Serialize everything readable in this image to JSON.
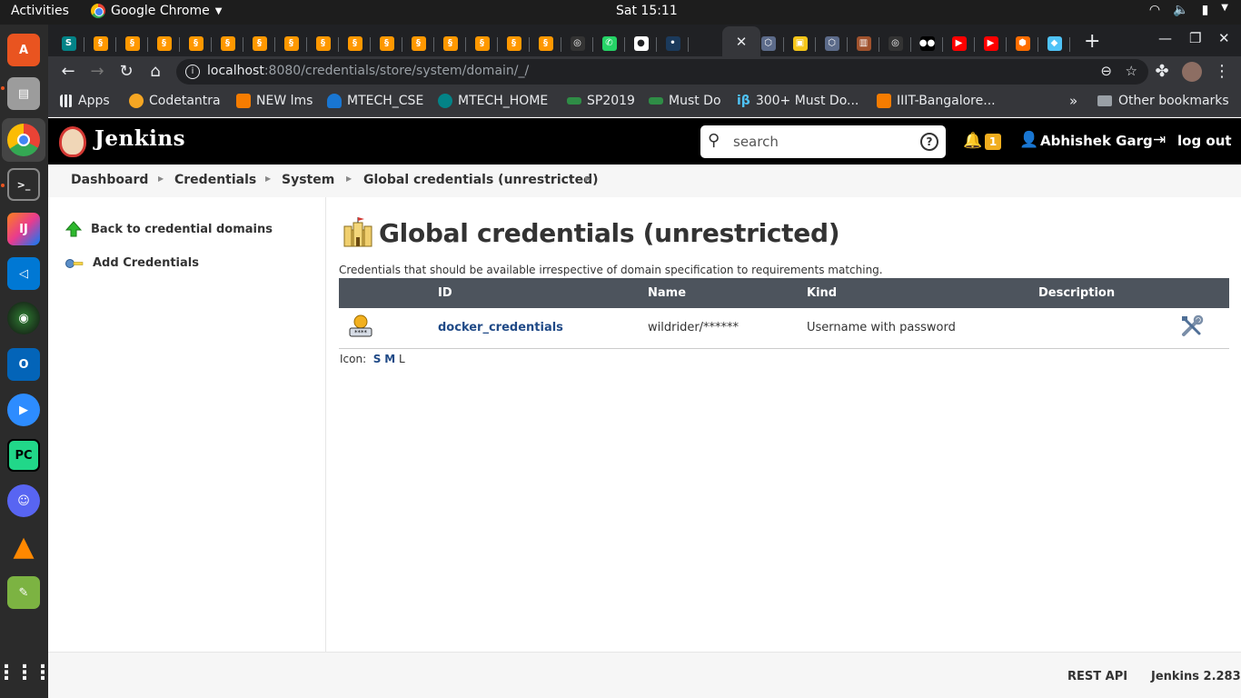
{
  "os": {
    "activities": "Activities",
    "app_menu": "Google Chrome",
    "clock": "Sat 15:11"
  },
  "browser": {
    "url_host": "localhost",
    "url_rest": ":8080/credentials/store/system/domain/_/",
    "bookmarks": [
      "Apps",
      "Codetantra",
      "NEW lms",
      "MTECH_CSE",
      "MTECH_HOME",
      "SP2019",
      "Must Do",
      "300+ Must Do...",
      "IIIT-Bangalore..."
    ],
    "bookmarks_more": "»",
    "other_bookmarks": "Other bookmarks"
  },
  "jenkins": {
    "title": "Jenkins",
    "search_placeholder": "search",
    "notification_count": "1",
    "user": "Abhishek Garg",
    "logout": "log out"
  },
  "breadcrumb": [
    "Dashboard",
    "Credentials",
    "System",
    "Global credentials (unrestricted)"
  ],
  "sidepanel": {
    "back": "Back to credential domains",
    "add": "Add Credentials"
  },
  "main": {
    "title": "Global credentials (unrestricted)",
    "description": "Credentials that should be available irrespective of domain specification to requirements matching.",
    "columns": {
      "id": "ID",
      "name": "Name",
      "kind": "Kind",
      "description": "Description"
    },
    "rows": [
      {
        "id": "docker_credentials",
        "name": "wildrider/******",
        "kind": "Username with password",
        "description": ""
      }
    ],
    "icon_label": "Icon:",
    "icon_sizes": [
      "S",
      "M",
      "L"
    ]
  },
  "footer": {
    "rest_api": "REST API",
    "version": "Jenkins 2.283"
  },
  "colors": {
    "header_bg": "#000000",
    "table_header_bg": "#4d545d",
    "link": "#204a87",
    "badge": "#f0ad1e"
  }
}
